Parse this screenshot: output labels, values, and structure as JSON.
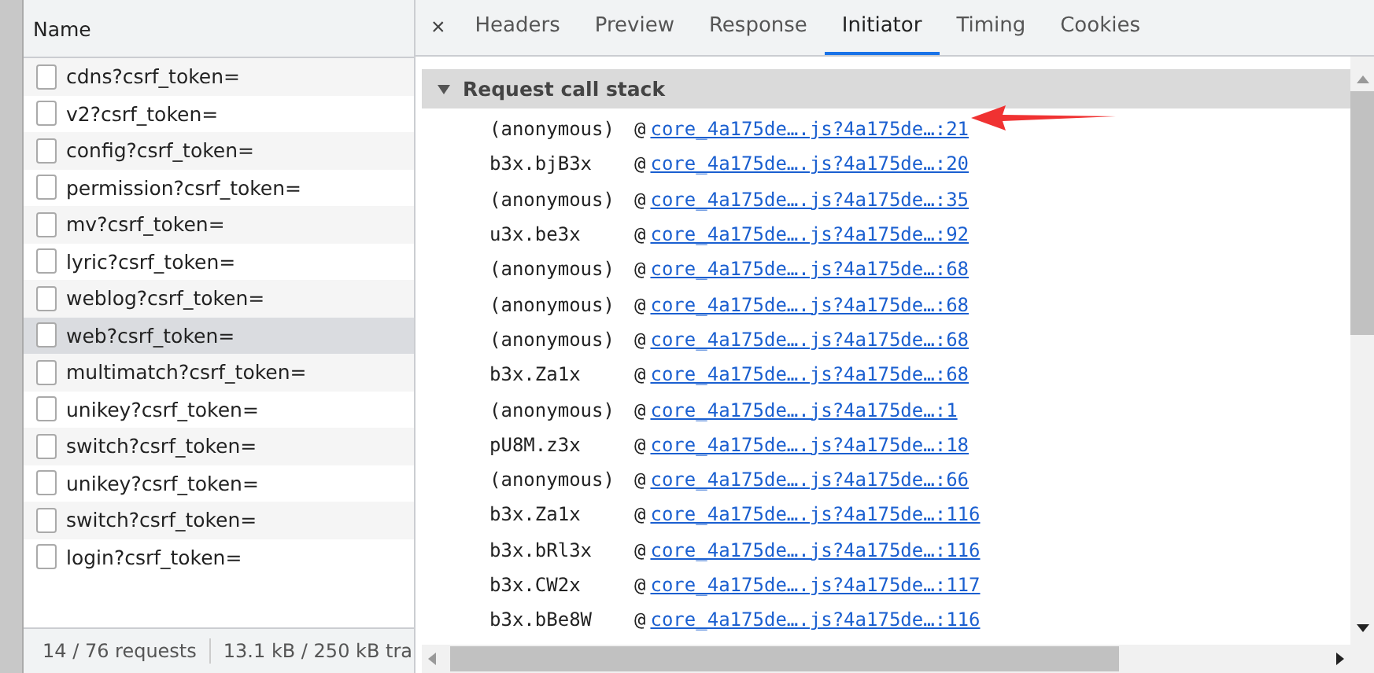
{
  "requests": {
    "column": "Name",
    "rows": [
      {
        "name": "cdns?csrf_token=",
        "selected": false
      },
      {
        "name": "v2?csrf_token=",
        "selected": false
      },
      {
        "name": "config?csrf_token=",
        "selected": false
      },
      {
        "name": "permission?csrf_token=",
        "selected": false
      },
      {
        "name": "mv?csrf_token=",
        "selected": false
      },
      {
        "name": "lyric?csrf_token=",
        "selected": false
      },
      {
        "name": "weblog?csrf_token=",
        "selected": false
      },
      {
        "name": "web?csrf_token=",
        "selected": true
      },
      {
        "name": "multimatch?csrf_token=",
        "selected": false
      },
      {
        "name": "unikey?csrf_token=",
        "selected": false
      },
      {
        "name": "switch?csrf_token=",
        "selected": false
      },
      {
        "name": "unikey?csrf_token=",
        "selected": false
      },
      {
        "name": "switch?csrf_token=",
        "selected": false
      },
      {
        "name": "login?csrf_token=",
        "selected": false
      }
    ],
    "status": [
      "14 / 76 requests",
      "13.1 kB / 250 kB tra"
    ]
  },
  "details": {
    "close": "×",
    "tabs": [
      {
        "label": "Headers",
        "selected": false
      },
      {
        "label": "Preview",
        "selected": false
      },
      {
        "label": "Response",
        "selected": false
      },
      {
        "label": "Initiator",
        "selected": true
      },
      {
        "label": "Timing",
        "selected": false
      },
      {
        "label": "Cookies",
        "selected": false
      }
    ],
    "section": {
      "title": "Request call stack",
      "expanded": true
    },
    "frames": [
      {
        "function": "(anonymous)",
        "at": "@",
        "source": "core_4a175de….js?4a175de…:21"
      },
      {
        "function": "b3x.bjB3x",
        "at": "@",
        "source": "core_4a175de….js?4a175de…:20"
      },
      {
        "function": "(anonymous)",
        "at": "@",
        "source": "core_4a175de….js?4a175de…:35"
      },
      {
        "function": "u3x.be3x",
        "at": "@",
        "source": "core_4a175de….js?4a175de…:92"
      },
      {
        "function": "(anonymous)",
        "at": "@",
        "source": "core_4a175de….js?4a175de…:68"
      },
      {
        "function": "(anonymous)",
        "at": "@",
        "source": "core_4a175de….js?4a175de…:68"
      },
      {
        "function": "(anonymous)",
        "at": "@",
        "source": "core_4a175de….js?4a175de…:68"
      },
      {
        "function": "b3x.Za1x",
        "at": "@",
        "source": "core_4a175de….js?4a175de…:68"
      },
      {
        "function": "(anonymous)",
        "at": "@",
        "source": "core_4a175de….js?4a175de…:1"
      },
      {
        "function": "pU8M.z3x",
        "at": "@",
        "source": "core_4a175de….js?4a175de…:18"
      },
      {
        "function": "(anonymous)",
        "at": "@",
        "source": "core_4a175de….js?4a175de…:66"
      },
      {
        "function": "b3x.Za1x",
        "at": "@",
        "source": "core_4a175de….js?4a175de…:116"
      },
      {
        "function": "b3x.bRl3x",
        "at": "@",
        "source": "core_4a175de….js?4a175de…:116"
      },
      {
        "function": "b3x.CW2x",
        "at": "@",
        "source": "core_4a175de….js?4a175de…:117"
      },
      {
        "function": "b3x.bBe8W",
        "at": "@",
        "source": "core_4a175de….js?4a175de…:116"
      }
    ]
  }
}
